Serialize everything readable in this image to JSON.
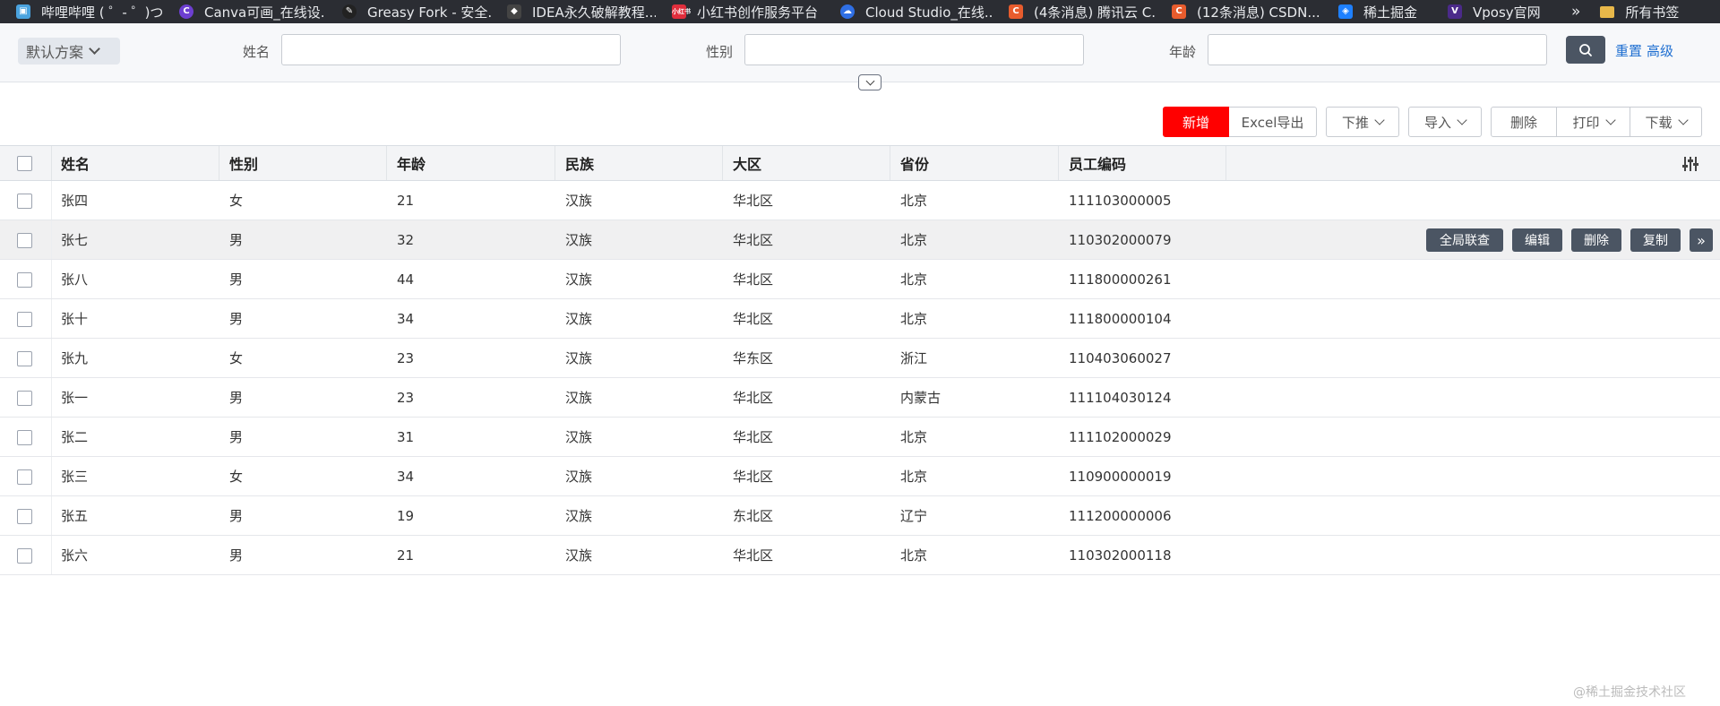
{
  "bookmarks": [
    {
      "label": "哔哩哔哩 ( ゜- ゜)つ...",
      "icon": "bilibili-icon",
      "color": "#4aa3df"
    },
    {
      "label": "Canva可画_在线设...",
      "icon": "canva-icon",
      "color": "#6d3fd1"
    },
    {
      "label": "Greasy Fork - 安全...",
      "icon": "greasyfork-icon",
      "color": "#222222"
    },
    {
      "label": "IDEA永久破解教程...",
      "icon": "idea-icon",
      "color": "#444444"
    },
    {
      "label": "小红书创作服务平台",
      "icon": "xiaohongshu-icon",
      "color": "#e02e3c"
    },
    {
      "label": "Cloud Studio_在线...",
      "icon": "cloudstudio-icon",
      "color": "#2f6fe4"
    },
    {
      "label": "(4条消息) 腾讯云 C...",
      "icon": "csdn-icon",
      "color": "#e85c2d"
    },
    {
      "label": "(12条消息) CSDN...",
      "icon": "csdn-icon",
      "color": "#e85c2d"
    },
    {
      "label": "稀土掘金",
      "icon": "juejin-icon",
      "color": "#1e80ff"
    },
    {
      "label": "Vposy官网",
      "icon": "vposy-icon",
      "color": "#4b2a8a"
    }
  ],
  "bookmarks_more": "»",
  "bookmarks_folder": "所有书签",
  "search": {
    "plan_label": "默认方案",
    "fields": [
      {
        "label": "姓名",
        "value": ""
      },
      {
        "label": "性别",
        "value": ""
      },
      {
        "label": "年龄",
        "value": ""
      }
    ],
    "reset_label": "重置",
    "advanced_label": "高级"
  },
  "toolbar": {
    "add": "新增",
    "excel_export": "Excel导出",
    "push_down": "下推",
    "import": "导入",
    "delete": "删除",
    "print": "打印",
    "download": "下载"
  },
  "table": {
    "columns": [
      "姓名",
      "性别",
      "年龄",
      "民族",
      "大区",
      "省份",
      "员工编码"
    ],
    "rows": [
      [
        "张四",
        "女",
        "21",
        "汉族",
        "华北区",
        "北京",
        "111103000005"
      ],
      [
        "张七",
        "男",
        "32",
        "汉族",
        "华北区",
        "北京",
        "110302000079"
      ],
      [
        "张八",
        "男",
        "44",
        "汉族",
        "华北区",
        "北京",
        "111800000261"
      ],
      [
        "张十",
        "男",
        "34",
        "汉族",
        "华北区",
        "北京",
        "111800000104"
      ],
      [
        "张九",
        "女",
        "23",
        "汉族",
        "华东区",
        "浙江",
        "110403060027"
      ],
      [
        "张一",
        "男",
        "23",
        "汉族",
        "华北区",
        "内蒙古",
        "111104030124"
      ],
      [
        "张二",
        "男",
        "31",
        "汉族",
        "华北区",
        "北京",
        "111102000029"
      ],
      [
        "张三",
        "女",
        "34",
        "汉族",
        "华北区",
        "北京",
        "110900000019"
      ],
      [
        "张五",
        "男",
        "19",
        "汉族",
        "东北区",
        "辽宁",
        "111200000006"
      ],
      [
        "张六",
        "男",
        "21",
        "汉族",
        "华北区",
        "北京",
        "110302000118"
      ]
    ],
    "row_actions": [
      "全局联查",
      "编辑",
      "删除",
      "复制"
    ],
    "row_actions_more": "»"
  },
  "watermark": "@稀土掘金技术社区",
  "colors": {
    "primary_red": "#ff0000",
    "dark_button": "#4b5563",
    "link_blue": "#1f6fd1"
  }
}
